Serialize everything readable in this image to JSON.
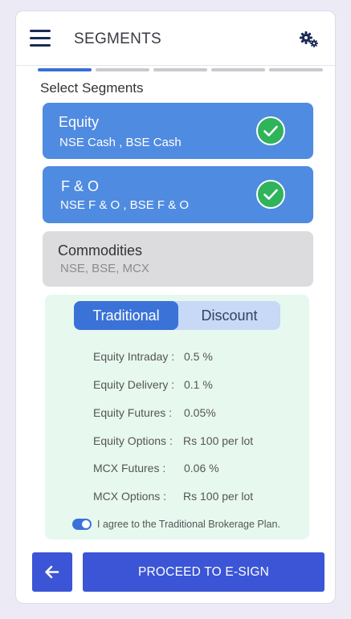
{
  "header": {
    "title": "SEGMENTS"
  },
  "progress": {
    "total_steps": 5,
    "current_step": 1
  },
  "section_label": "Select Segments",
  "segments": [
    {
      "name": "Equity",
      "exchanges": "NSE Cash , BSE Cash",
      "selected": true
    },
    {
      "name": "F & O",
      "exchanges": "NSE F & O , BSE  F & O",
      "selected": true
    },
    {
      "name": "Commodities",
      "exchanges": "NSE,  BSE,  MCX",
      "selected": false
    }
  ],
  "brokerage": {
    "tabs": [
      "Traditional",
      "Discount"
    ],
    "active_tab": "Traditional",
    "rates": [
      {
        "label": "Equity Intraday  :",
        "value": "0.5 %"
      },
      {
        "label": "Equity Delivery  :",
        "value": "0.1 %"
      },
      {
        "label": "Equity Futures   :",
        "value": "0.05%"
      },
      {
        "label": "Equity Options  :",
        "value": "Rs 100 per lot"
      },
      {
        "label": "MCX Futures    :",
        "value": "0.06 %"
      },
      {
        "label": "MCX Options    :",
        "value": "Rs 100 per lot"
      }
    ],
    "agree_text": "I agree to the Traditional Brokerage Plan.",
    "agree_checked": true
  },
  "footer": {
    "proceed_label": "PROCEED TO E-SIGN"
  },
  "colors": {
    "accent": "#3b55d6",
    "segment_selected": "#4f8be0",
    "segment_unselected": "#dcdcdf",
    "check_green": "#2fb35b",
    "brokerage_bg": "#e7f8ef"
  }
}
